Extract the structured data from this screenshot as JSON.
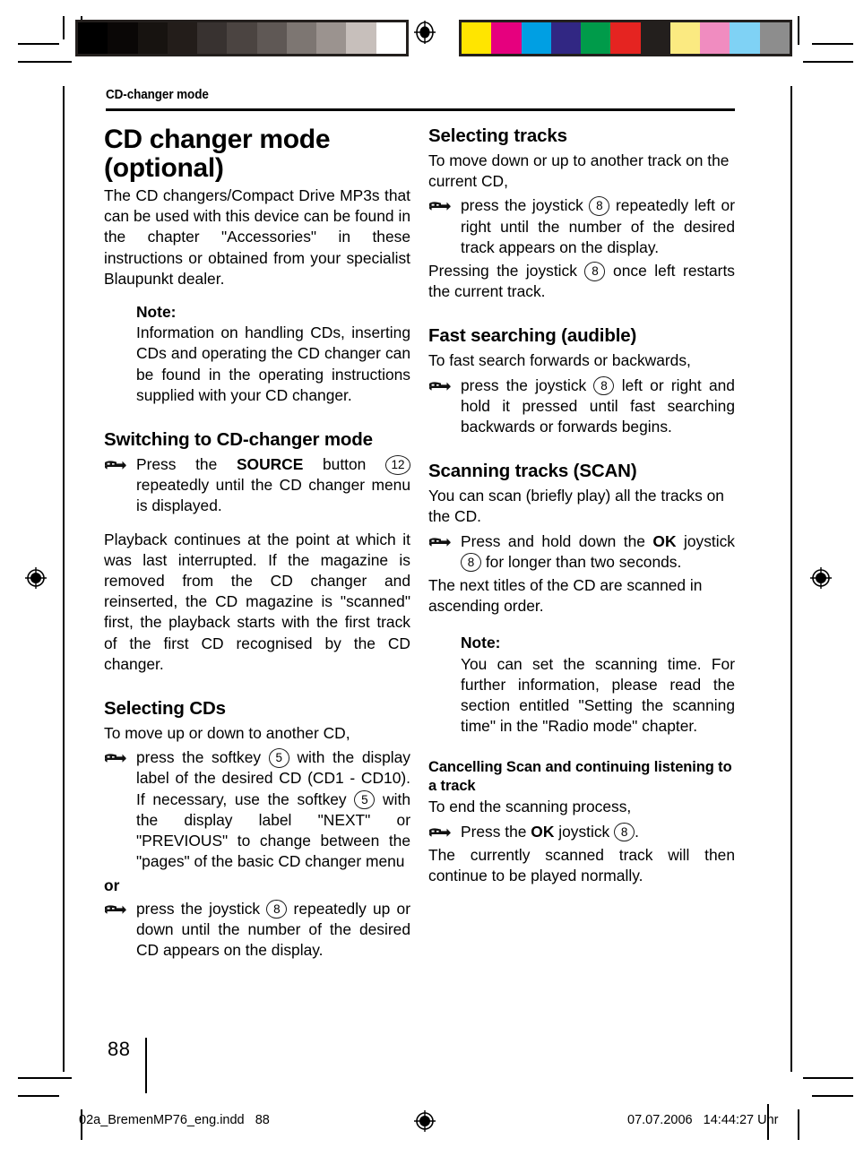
{
  "document": {
    "running_head": "CD-changer mode",
    "page_number": "88"
  },
  "calibration": {
    "gray_bar_name": "grayscale-calibration-bar",
    "gray_swatches": [
      "#000000",
      "#0a0706",
      "#171310",
      "#231d1a",
      "#383230",
      "#4b4441",
      "#5f5855",
      "#7d7672",
      "#9b938f",
      "#c7bfbb",
      "#ffffff"
    ],
    "color_bar_name": "color-calibration-bar",
    "color_swatches": [
      "#ffe500",
      "#e6007e",
      "#009fe3",
      "#312783",
      "#009b4a",
      "#e52421",
      "#231f1d",
      "#fbea81",
      "#f08cc0",
      "#7fd2f5",
      "#8d8d8d"
    ]
  },
  "left_column": {
    "title_line1": "CD changer mode",
    "title_line2": "(optional)",
    "intro": "The CD changers/Compact Drive MP3s that can be used with this device can be found in the chapter \"Accessories\" in these instructions or obtained from your specialist Blaupunkt dealer.",
    "note_label": "Note:",
    "note_body": "Information on handling CDs, inserting CDs and operating the CD changer can be found in the operating instructions supplied with your CD changer.",
    "heading_switching": "Switching to CD-changer mode",
    "step_source_a": "Press the ",
    "step_source_bold": "SOURCE",
    "step_source_b": " button ",
    "step_source_key": "12",
    "step_source_c": " repeatedly until the CD changer menu is displayed.",
    "playback_para": "Playback continues at the point at which it was last interrupted. If the magazine is removed from the CD changer and reinserted, the CD magazine is \"scanned\" first, the playback starts with the first track of the first CD recognised by the CD changer.",
    "heading_selecting_cds": "Selecting CDs",
    "selecting_cds_intro": "To move up or down to another CD,",
    "step_softkey_a": "press the softkey ",
    "step_softkey_key1": "5",
    "step_softkey_b": " with the display label of the desired CD (CD1 - CD10). If necessary, use the softkey ",
    "step_softkey_key2": "5",
    "step_softkey_c": " with the display label \"NEXT\" or \"PREVIOUS\" to change between the \"pages\" of the basic CD changer menu",
    "or_label": "or",
    "step_joystick_a": "press the joystick ",
    "step_joystick_key": "8",
    "step_joystick_b": " repeatedly up or down until the number of the desired CD appears on the display."
  },
  "right_column": {
    "heading_selecting_tracks": "Selecting tracks",
    "selecting_tracks_intro": "To move down or up to another track on the current CD,",
    "step_tracks_a": "press the joystick ",
    "step_tracks_key": "8",
    "step_tracks_b": " repeatedly left or right until the number of the desired track appears on the display.",
    "pressing_a": "Pressing the joystick ",
    "pressing_key": "8",
    "pressing_b": " once left restarts the current track.",
    "heading_fast_searching": "Fast searching (audible)",
    "fast_intro": "To fast search forwards or backwards,",
    "step_fast_a": "press the joystick ",
    "step_fast_key": "8",
    "step_fast_b": " left or right and hold it pressed until fast searching backwards or forwards begins.",
    "heading_scanning": "Scanning tracks (SCAN)",
    "scanning_intro": "You can scan (briefly play) all the tracks on the CD.",
    "step_scan_a": "Press and hold down the ",
    "step_scan_bold": "OK",
    "step_scan_b": " joystick ",
    "step_scan_key": "8",
    "step_scan_c": " for longer than two seconds.",
    "scanning_after": "The next titles of the CD are scanned in ascending order.",
    "note_label": "Note:",
    "note_body": "You can set the scanning time. For further information, please read the section entitled \"Setting the scanning time\" in the \"Radio mode\" chapter.",
    "subheading_cancelling": "Cancelling Scan and continuing listening to a track",
    "cancelling_intro": "To end the scanning process,",
    "step_cancel_a": "Press the ",
    "step_cancel_bold": "OK",
    "step_cancel_b": " joystick ",
    "step_cancel_key": "8",
    "step_cancel_c": "."
  },
  "slug": {
    "left": "02a_BremenMP76_eng.indd   88",
    "right": "07.07.2006   14:44:27 Uhr"
  }
}
